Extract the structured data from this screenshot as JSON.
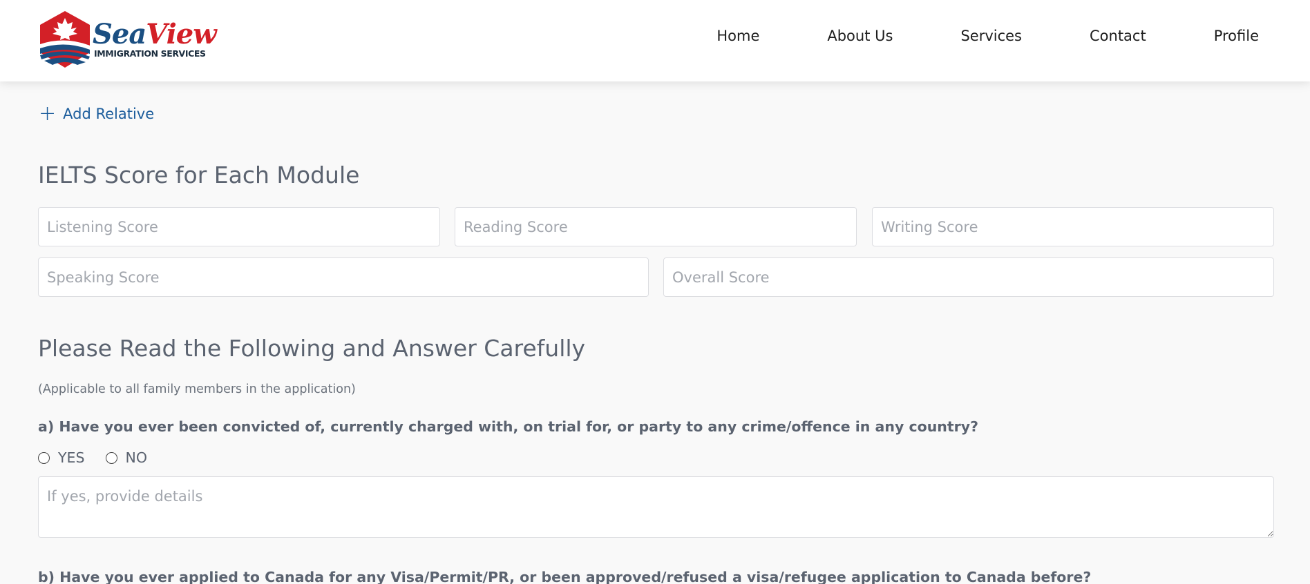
{
  "brand": {
    "name_part1": "Sea",
    "name_part2": "View",
    "subtitle": "IMMIGRATION SERVICES",
    "colors": {
      "red": "#d32027",
      "blue": "#1b4f82"
    }
  },
  "nav": {
    "items": [
      {
        "label": "Home"
      },
      {
        "label": "About Us"
      },
      {
        "label": "Services"
      },
      {
        "label": "Contact"
      },
      {
        "label": "Profile"
      }
    ]
  },
  "add_relative": {
    "icon": "plus-icon",
    "label": "Add Relative"
  },
  "ielts": {
    "title": "IELTS Score for Each Module",
    "fields": {
      "listening": {
        "placeholder": "Listening Score",
        "value": ""
      },
      "reading": {
        "placeholder": "Reading Score",
        "value": ""
      },
      "writing": {
        "placeholder": "Writing Score",
        "value": ""
      },
      "speaking": {
        "placeholder": "Speaking Score",
        "value": ""
      },
      "overall": {
        "placeholder": "Overall Score",
        "value": ""
      }
    }
  },
  "questions_section": {
    "title": "Please Read the Following and Answer Carefully",
    "note": "(Applicable to all family members in the application)",
    "q_a": {
      "text": "a) Have you ever been convicted of, currently charged with, on trial for, or party to any crime/offence in any country?",
      "options": [
        "YES",
        "NO"
      ],
      "details_placeholder": "If yes, provide details"
    },
    "q_b": {
      "text": "b) Have you ever applied to Canada for any Visa/Permit/PR, or been approved/refused a visa/refugee application to Canada before?"
    }
  }
}
